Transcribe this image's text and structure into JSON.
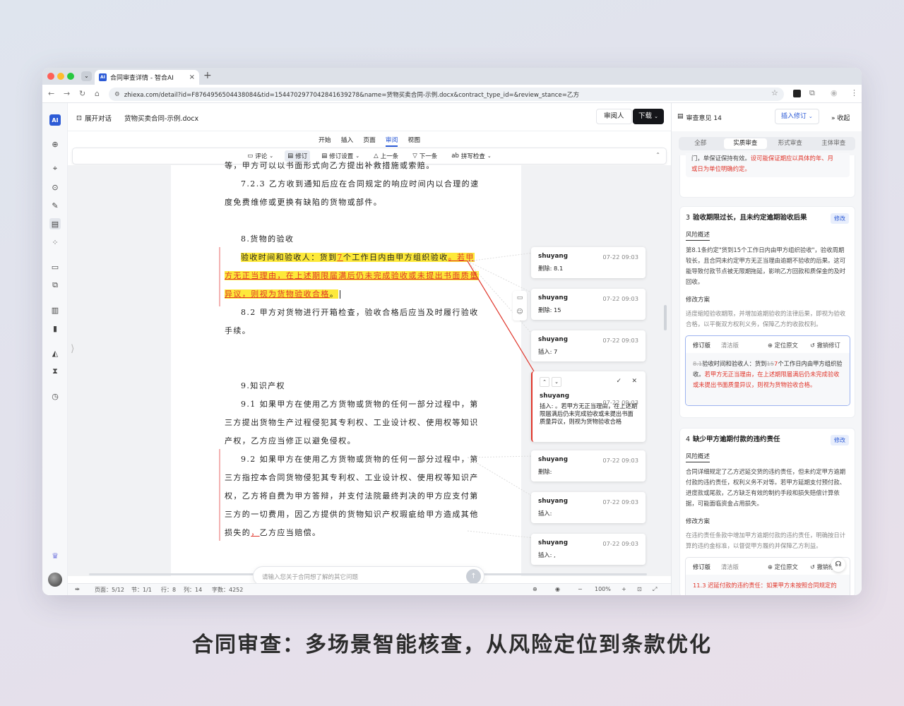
{
  "browser": {
    "tab_title": "合同审查详情 - 智合AI",
    "tab_close": "×",
    "new_tab": "+",
    "url": "zhiexa.com/detail?id=F8764956504438084&tid=1544702977042841639278&name=货物买卖合同-示例.docx&contract_type_id=&review_stance=乙方",
    "favicon_text": "AI",
    "traffic_colors": [
      "#fe5f57",
      "#febc2e",
      "#28c840"
    ]
  },
  "sidebar": {
    "logo": "AI"
  },
  "topbar": {
    "expand_label": "展开对话",
    "doc_title": "货物买卖合同-示例.docx",
    "reviewer_label": "审阅人",
    "download_label": "下载"
  },
  "menu": [
    "开始",
    "插入",
    "页面",
    "审阅",
    "视图"
  ],
  "toolbar": {
    "comment": "评论",
    "track": "修订",
    "track_settings": "修订设置",
    "prev": "上一条",
    "next": "下一条",
    "spellcheck": "拼写检查"
  },
  "doc": {
    "l0": "等，甲方可以以书面形式向乙方提出补救措施或索赔。",
    "l1": "7.2.3 乙方收到通知后应在合同规定的响应时间内以合理的速",
    "l2": "度免费维修或更换有缺陷的货物或部件。",
    "l3": "8.货物的验收",
    "l4a": "验收时间和验收人：货到",
    "l4b": "7",
    "l4c": "个工作日内由甲方组织验收",
    "l4d": "。若甲",
    "l5": "方无正当理由，在上述期限届满后仍未完成验收或未提出书面质量",
    "l6a": "异议，则视为货物验收合格",
    "l6b": "。",
    "l7": "8.2  甲方对货物进行开箱检查，验收合格后应当及时履行验收",
    "l8": "手续。",
    "l9": "9.知识产权",
    "l10": "9.1  如果甲方在使用乙方货物或货物的任何一部分过程中，第",
    "l11": "三方提出货物生产过程侵犯其专利权、工业设计权、使用权等知识",
    "l12": "产权，乙方应当修正以避免侵权。",
    "l13": "9.2 如果甲方在使用乙方货物或货物的任何一部分过程中，第",
    "l14": "三方指控本合同货物侵犯其专利权、工业设计权、使用权等知识产",
    "l15": "权，乙方将自费为甲方答辩，并支付法院最终判决的甲方应支付第",
    "l16": "三方的一切费用，因乙方提供的货物知识产权瑕疵给甲方造成其他",
    "l17a": "损失的",
    "l17b": "，",
    "l17c": "乙方应当赔偿。"
  },
  "comments": [
    {
      "user": "shuyang",
      "time": "07-22 09:03",
      "body": "删除: 8.1"
    },
    {
      "user": "shuyang",
      "time": "07-22 09:03",
      "body": "删除: 15"
    },
    {
      "user": "shuyang",
      "time": "07-22 09:03",
      "body": "插入: 7"
    },
    {
      "user": "shuyang",
      "time": "07-22 09:03",
      "body": "插入: 。若甲方无正当理由，在上述期限届满后仍未完成验收或未提出书面质量异议，则视为货物验收合格"
    },
    {
      "user": "shuyang",
      "time": "07-22 09:03",
      "body": "删除:"
    },
    {
      "user": "shuyang",
      "time": "07-22 09:03",
      "body": "插入:"
    },
    {
      "user": "shuyang",
      "time": "07-22 09:03",
      "body": "插入: ,"
    }
  ],
  "ask": {
    "placeholder": "请输入您关于合同想了解的其它问题"
  },
  "status": {
    "page": "页面：5/12",
    "section": "节：1/1",
    "row": "行：8",
    "col": "列：14",
    "words": "字数：4252",
    "zoom": "100%"
  },
  "panel": {
    "title": "审查意见 14",
    "insert_btn": "插入修订",
    "collapse": "收起",
    "tabs": [
      "全部",
      "实质审查",
      "形式审查",
      "主体审查"
    ],
    "card0_line1": "门，单保证保持有效。",
    "card0_line1_red": "设可能保证期应以具体的年、月",
    "card0_line2_red": "或日为单位明确约定。",
    "card3": {
      "num": "3",
      "title": "验收期限过长，且未约定逾期验收后果",
      "edit": "修改",
      "overview_label": "风险概述",
      "overview": "第8.1条约定\"货到15个工作日内由甲方组织验收\"，验收周期较长，且合同未约定甲方无正当理由逾期不验收的后果。这可能导致付款节点被无限期拖延，影响乙方回款和质保金的及时回收。",
      "plan_label": "修改方案",
      "plan": "适度缩短验收期限，并增加逾期验收的法律后果，即视为验收合格，以平衡双方权利义务，保障乙方的收款权利。",
      "rev_tab": "修订版",
      "clean_tab": "清洁版",
      "locate": "定位原文",
      "undo": "撤销修订",
      "rev_del1": "8.1",
      "rev_a": "验收时间和验收人：货到",
      "rev_del2": "15",
      "rev_ins1": "7",
      "rev_b": "个工作日内由甲方组织验收。",
      "rev_ins2": "若甲方无正当理由，在上述期限届满后仍未完成验收或未提出书面质量异议，则视为货物验收合格。"
    },
    "card4": {
      "num": "4",
      "title": "缺少甲方逾期付款的违约责任",
      "edit": "修改",
      "overview_label": "风险概述",
      "overview": "合同详细规定了乙方迟延交货的违约责任，但未约定甲方逾期付款的违约责任，权利义务不对等。若甲方延期支付预付款、进度款或尾款，乙方缺乏有效的制约手段和损失赔偿计算依据，可能面临资金占用损失。",
      "plan_label": "修改方案",
      "plan": "在违约责任条款中增加甲方逾期付款的违约责任，明确按日计算的违约金标准，以督促甲方履约并保障乙方利益。",
      "rev_tab": "修订版",
      "clean_tab": "清洁版",
      "locate": "定位原文",
      "undo": "撤销修",
      "rev_text": "11.3 迟延付款的违约责任：如果甲方未按照合同规定的"
    }
  },
  "caption": "合同审查：多场景智能核查，从风险定位到条款优化"
}
